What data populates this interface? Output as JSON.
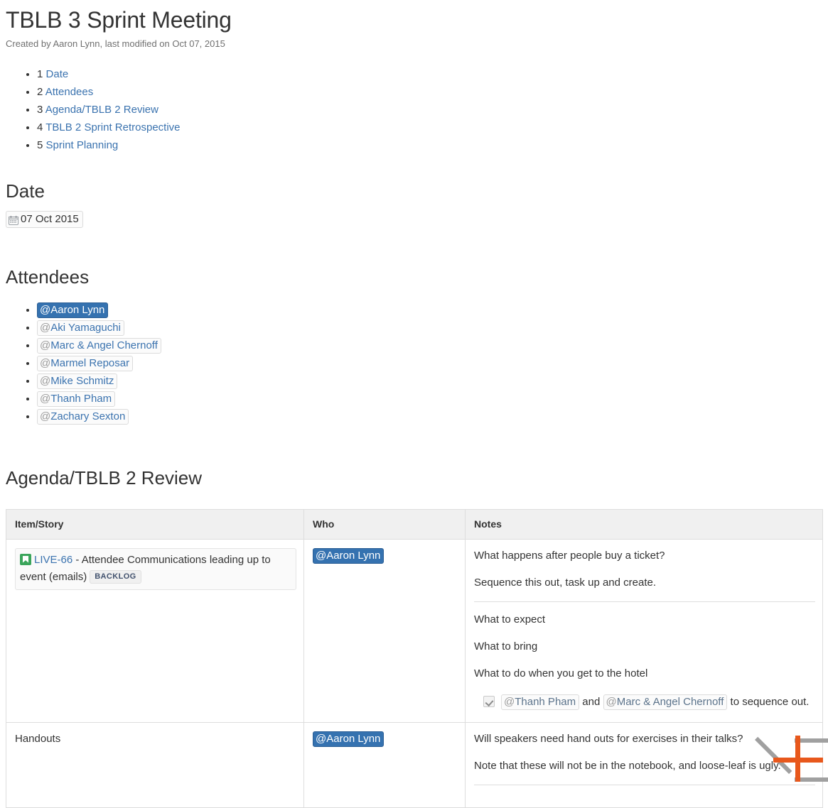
{
  "header": {
    "title": "TBLB 3 Sprint Meeting",
    "meta": "Created by Aaron Lynn, last modified on Oct 07, 2015"
  },
  "toc": {
    "items": [
      {
        "num": "1",
        "label": "Date"
      },
      {
        "num": "2",
        "label": "Attendees"
      },
      {
        "num": "3",
        "label": "Agenda/TBLB 2 Review"
      },
      {
        "num": "4",
        "label": "TBLB 2 Sprint Retrospective"
      },
      {
        "num": "5",
        "label": "Sprint Planning"
      }
    ]
  },
  "sections": {
    "date_heading": "Date",
    "attendees_heading": "Attendees",
    "agenda_heading": "Agenda/TBLB 2 Review"
  },
  "date": {
    "icon": "calendar-icon",
    "value": "07 Oct 2015"
  },
  "attendees": [
    {
      "at": "@",
      "name": "Aaron Lynn",
      "current": true
    },
    {
      "at": "@",
      "name": "Aki Yamaguchi",
      "current": false
    },
    {
      "at": "@",
      "name": "Marc & Angel Chernoff",
      "current": false
    },
    {
      "at": "@",
      "name": "Marmel Reposar",
      "current": false
    },
    {
      "at": "@",
      "name": "Mike Schmitz",
      "current": false
    },
    {
      "at": "@",
      "name": "Thanh Pham",
      "current": false
    },
    {
      "at": "@",
      "name": "Zachary Sexton",
      "current": false
    }
  ],
  "table": {
    "columns": [
      "Item/Story",
      "Who",
      "Notes"
    ],
    "rows": [
      {
        "issue": {
          "icon": "jira-story-icon",
          "key": "LIVE-66",
          "separator": " - ",
          "summary": "Attendee Communications leading up to event (emails)",
          "status": "BACKLOG"
        },
        "who": {
          "at": "@",
          "name": "Aaron Lynn"
        },
        "notes": {
          "para1": "What happens after people buy a ticket?",
          "para2": "Sequence this out, task up and create.",
          "para3": "What to expect",
          "para4": "What to bring",
          "para5": "What to do when you get to the hotel",
          "task": {
            "checked": true,
            "mention1_at": "@",
            "mention1": "Thanh Pham",
            "joiner": " and ",
            "mention2_at": "@",
            "mention2": "Marc & Angel Chernoff",
            "tail": " to sequence out."
          }
        }
      },
      {
        "item": "Handouts",
        "who": {
          "at": "@",
          "name": "Aaron Lynn"
        },
        "notes": {
          "para1": "Will speakers need hand outs for exercises in their talks?",
          "para2": "Note that these will not be in the notebook, and loose-leaf is ugly."
        }
      }
    ]
  },
  "cursor": {
    "type": "crosshair-cursor",
    "accent_color": "#e8581c",
    "frame_color": "#a0a0a0"
  }
}
